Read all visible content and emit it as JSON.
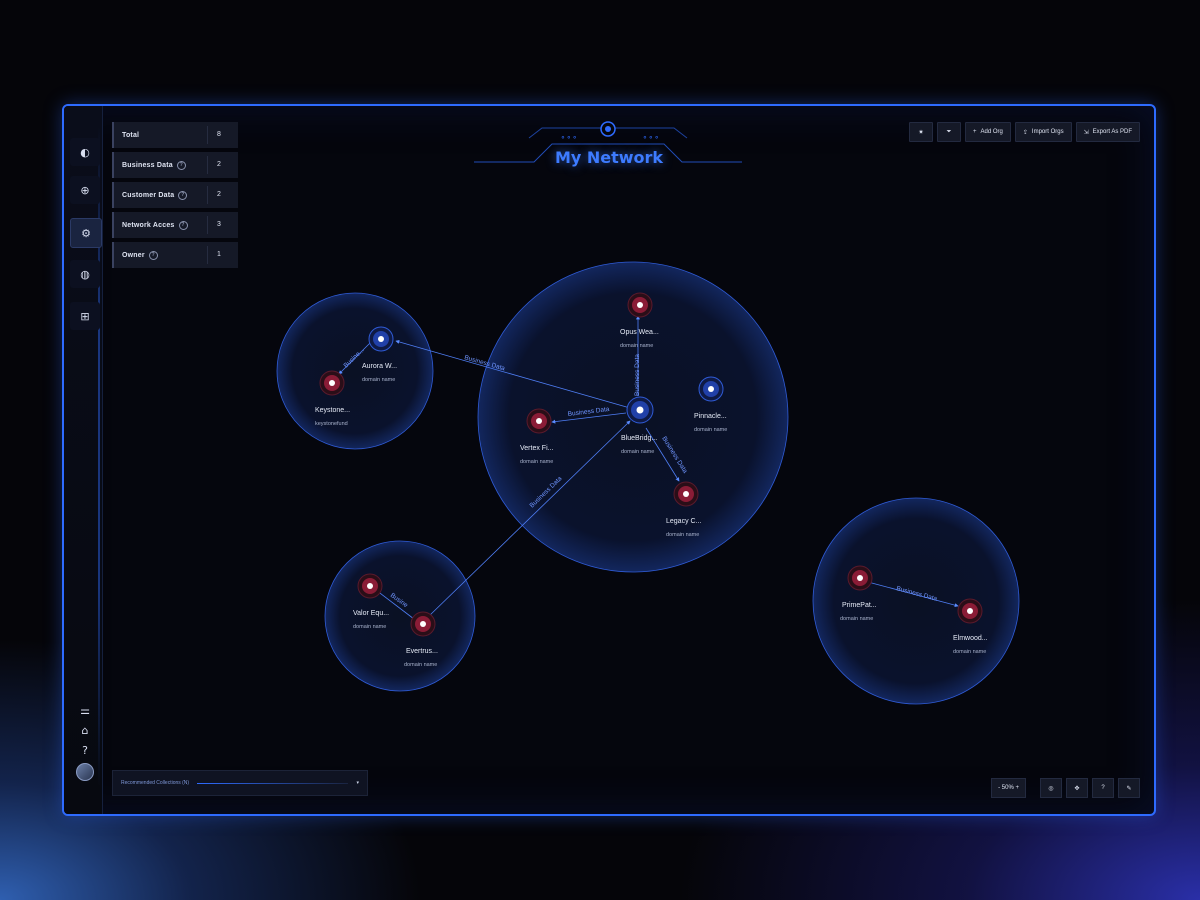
{
  "app": {
    "title": "My Network"
  },
  "stats": [
    {
      "label": "Total",
      "value": "8",
      "help": false
    },
    {
      "label": "Business Data",
      "value": "2",
      "help": true
    },
    {
      "label": "Customer Data",
      "value": "2",
      "help": true
    },
    {
      "label": "Network Acces",
      "value": "3",
      "help": true
    },
    {
      "label": "Owner",
      "value": "1",
      "help": true
    }
  ],
  "toolbar": {
    "add_org": "Add Org",
    "import_orgs": "Import Orgs",
    "export_pdf": "Export As PDF"
  },
  "nodes": {
    "aurora": {
      "name": "Aurora W...",
      "sub": "domain name"
    },
    "keystone": {
      "name": "Keystone...",
      "sub": "keystonefund"
    },
    "opus": {
      "name": "Opus Wea...",
      "sub": "domain name"
    },
    "pinnacle": {
      "name": "Pinnacle...",
      "sub": "domain name"
    },
    "vertex": {
      "name": "Vertex Fi...",
      "sub": "domain name"
    },
    "bluebridge": {
      "name": "BlueBridg...",
      "sub": "domain name"
    },
    "legacy": {
      "name": "Legacy C...",
      "sub": "domain name"
    },
    "valor": {
      "name": "Valor Equ...",
      "sub": "domain name"
    },
    "evertrust": {
      "name": "Evertrus...",
      "sub": "domain name"
    },
    "primepat": {
      "name": "PrimePat...",
      "sub": "domain name"
    },
    "elmwood": {
      "name": "Elmwood...",
      "sub": "domain name"
    }
  },
  "edges": {
    "aurora_keystone": "Busine...",
    "bluebridge_aurora": "Business Data",
    "bluebridge_opus": "Business Data",
    "bluebridge_vertex": "Business Data",
    "bluebridge_legacy": "Business Data",
    "evertrust_bluebridge": "Business Data",
    "evertrust_valor": "Busine",
    "primepat_elmwood": "Business Data"
  },
  "recommended": {
    "label": "Recommended Collections (N)"
  },
  "zoom": {
    "label": "- 50% +"
  },
  "colors": {
    "accent": "#2e6bff",
    "node_red": "#7a1a2c",
    "node_blue": "#1c2f73",
    "title": "#3d7bff"
  }
}
